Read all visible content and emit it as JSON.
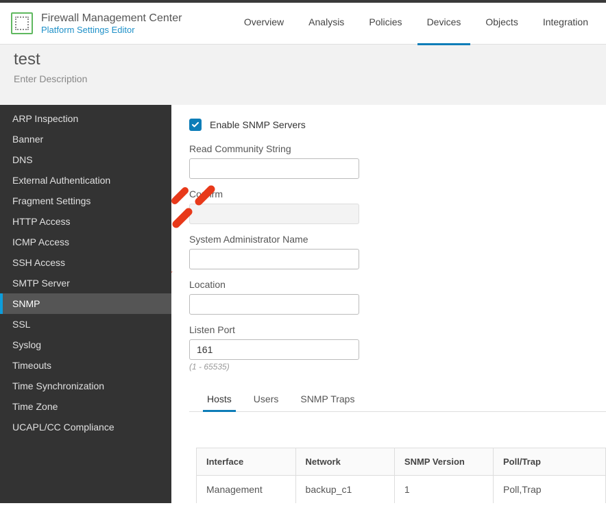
{
  "header": {
    "app_title": "Firewall Management Center",
    "app_subtitle": "Platform Settings Editor",
    "nav": [
      {
        "label": "Overview",
        "active": false
      },
      {
        "label": "Analysis",
        "active": false
      },
      {
        "label": "Policies",
        "active": false
      },
      {
        "label": "Devices",
        "active": true
      },
      {
        "label": "Objects",
        "active": false
      },
      {
        "label": "Integration",
        "active": false
      }
    ]
  },
  "page": {
    "title": "test",
    "description": "Enter Description"
  },
  "sidebar": {
    "items": [
      {
        "label": "ARP Inspection",
        "active": false
      },
      {
        "label": "Banner",
        "active": false
      },
      {
        "label": "DNS",
        "active": false
      },
      {
        "label": "External Authentication",
        "active": false
      },
      {
        "label": "Fragment Settings",
        "active": false
      },
      {
        "label": "HTTP Access",
        "active": false
      },
      {
        "label": "ICMP Access",
        "active": false
      },
      {
        "label": "SSH Access",
        "active": false
      },
      {
        "label": "SMTP Server",
        "active": false
      },
      {
        "label": "SNMP",
        "active": true
      },
      {
        "label": "SSL",
        "active": false
      },
      {
        "label": "Syslog",
        "active": false
      },
      {
        "label": "Timeouts",
        "active": false
      },
      {
        "label": "Time Synchronization",
        "active": false
      },
      {
        "label": "Time Zone",
        "active": false
      },
      {
        "label": "UCAPL/CC Compliance",
        "active": false
      }
    ]
  },
  "form": {
    "enable_checkbox_label": "Enable SNMP Servers",
    "enable_checked": true,
    "read_community_label": "Read Community String",
    "read_community_value": "",
    "confirm_label": "Confirm",
    "confirm_value": "",
    "sysadmin_label": "System Administrator Name",
    "sysadmin_value": "",
    "location_label": "Location",
    "location_value": "",
    "listen_port_label": "Listen Port",
    "listen_port_value": "161",
    "listen_port_hint": "(1 - 65535)"
  },
  "tabs": [
    {
      "label": "Hosts",
      "active": true
    },
    {
      "label": "Users",
      "active": false
    },
    {
      "label": "SNMP Traps",
      "active": false
    }
  ],
  "table": {
    "columns": [
      "Interface",
      "Network",
      "SNMP Version",
      "Poll/Trap"
    ],
    "rows": [
      {
        "interface": "Management",
        "network": "backup_c1",
        "snmp_version": "1",
        "poll_trap": "Poll,Trap"
      }
    ]
  }
}
